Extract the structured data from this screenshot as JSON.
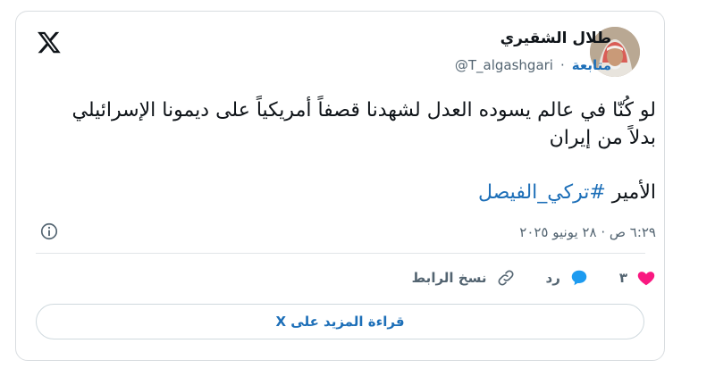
{
  "author": {
    "name": "طلال الشقيري",
    "handle": "@T_algashgari",
    "follow_label": "متابعة",
    "separator": "·"
  },
  "tweet": {
    "text": "لو كُنّا في عالم يسوده العدل لشهدنا قصفاً أمريكياً على ديمونا الإسرائيلي بدلاً من إيران",
    "prefix": "الأمير",
    "hashtag": "#تركي_الفيصل",
    "timestamp": "٦:٢٩ ص · ٢٨ يونيو ٢٠٢٥"
  },
  "actions": {
    "like_count": "٣",
    "reply_label": "رد",
    "copy_link_label": "نسخ الرابط"
  },
  "read_more_label": "قراءة المزيد على X",
  "colors": {
    "link": "#1d6fb8",
    "like": "#f91880",
    "reply": "#1d9bf0",
    "muted": "#536471"
  },
  "icons": [
    "x-logo-icon",
    "info-icon",
    "heart-icon",
    "reply-bubble-icon",
    "link-icon"
  ]
}
